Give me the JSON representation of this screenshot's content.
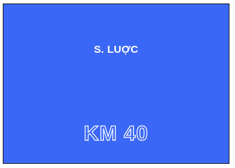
{
  "slide": {
    "background_color": "#3a67f5",
    "subtitle": "S. LUỢC",
    "title": "KM 40"
  }
}
